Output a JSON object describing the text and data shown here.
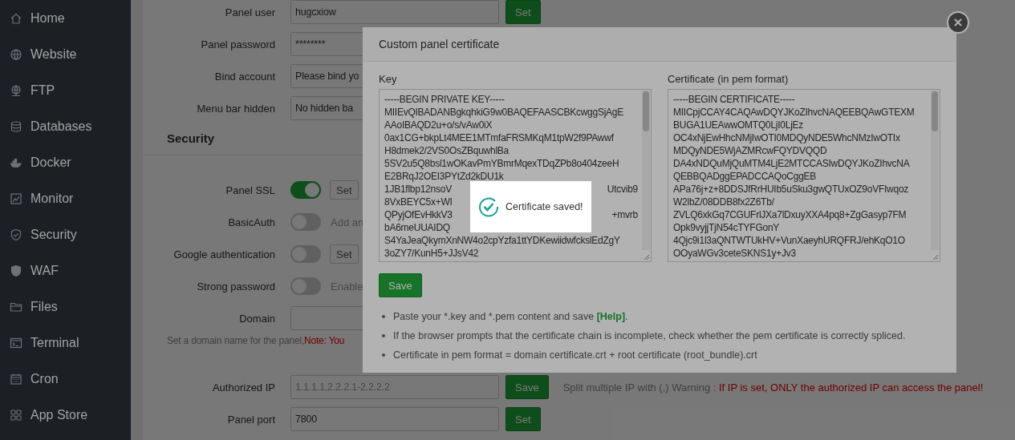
{
  "sidebar": {
    "items": [
      {
        "label": "Home"
      },
      {
        "label": "Website"
      },
      {
        "label": "FTP"
      },
      {
        "label": "Databases"
      },
      {
        "label": "Docker"
      },
      {
        "label": "Monitor"
      },
      {
        "label": "Security"
      },
      {
        "label": "WAF"
      },
      {
        "label": "Files"
      },
      {
        "label": "Terminal"
      },
      {
        "label": "Cron"
      },
      {
        "label": "App Store"
      }
    ]
  },
  "settings": {
    "rows": [
      {
        "kind": "input",
        "label": "Panel user",
        "value": "hugcxiow",
        "button": "Set"
      },
      {
        "kind": "input",
        "label": "Panel password",
        "value": "********"
      },
      {
        "kind": "select",
        "label": "Bind account",
        "value": "Please bind yo"
      },
      {
        "kind": "select",
        "label": "Menu bar hidden",
        "value": "No hidden ba"
      },
      {
        "kind": "heading",
        "text": "Security"
      },
      {
        "kind": "toggle",
        "label": "Panel SSL",
        "on": true,
        "button": "Set"
      },
      {
        "kind": "toggle",
        "label": "BasicAuth",
        "on": false,
        "note": "Add an"
      },
      {
        "kind": "toggle",
        "label": "Google authentication",
        "on": false,
        "button": "Set"
      },
      {
        "kind": "toggle",
        "label": "Strong password",
        "on": false,
        "note": "Enable"
      },
      {
        "kind": "input",
        "label": "Domain"
      },
      {
        "kind": "hint",
        "text": "Set a domain name for the panel,",
        "warning": "Note: You"
      },
      {
        "kind": "input",
        "label": "Authorized IP",
        "placeholder": "1.1.1.1,2.2.2.1-2.2.2.2",
        "button": "Save",
        "hint": "Split multiple IP with (,) Warning : ",
        "warning": "If IP is set, ONLY the authorized IP can access the panel!"
      },
      {
        "kind": "input",
        "label": "Panel port",
        "value": "7800",
        "button": "Set"
      }
    ]
  },
  "dialog": {
    "title": "Custom panel certificate",
    "key": {
      "label": "Key",
      "lines": [
        {
          "text": "-----BEGIN PRIVATE KEY-----"
        },
        {
          "text": "MIIEvQIBADANBgkqhkiG9w0BAQEFAASCBKcwggSjAgE"
        },
        {
          "text": "AAoIBAQD2u+o/s/vAw0iX"
        },
        {
          "text": "0ax1CG+bkpLt4MEE1MTmfaFRSMKqM1tpW2f9PAwwf"
        },
        {
          "text": "H8dmek2/2VS0OsZBquwhlBa"
        },
        {
          "text": "5SV2u5Q8bsl1wOKavPmYBmrMqexTDqZPb8o404zeeH"
        },
        {
          "text": "E2BRqJ2OEI3PYtZd2kDU1k"
        },
        {
          "start": "1JB1flbp12nsoV",
          "end": "Utcvib9"
        },
        {
          "start": "8VxBEYC5x+WI"
        },
        {
          "start": "QPyjOfEvHkkV3",
          "end": "+mvrb"
        },
        {
          "start": "bA6meUUAIDQ"
        },
        {
          "text": "S4YaJeaQkymXnNW4o2cpYzfa1ttYDKewiidwfckslEdZgY"
        },
        {
          "text": "3oZY7/KunH5+JJsV42"
        }
      ]
    },
    "certificate": {
      "label": "Certificate (in pem format)",
      "lines": [
        {
          "text": "-----BEGIN CERTIFICATE-----"
        },
        {
          "text": "MIICpjCCAY4CAQAwDQYJKoZIhvcNAQEEBQAwGTEXM"
        },
        {
          "text": "BUGA1UEAwwOMTQ0LjI0LjEz"
        },
        {
          "text": "OC4xNjEwHhcNMjIwOTI0MDQyNDE5WhcNMzIwOTIx"
        },
        {
          "text": "MDQyNDE5WjAZMRcwFQYDVQQD"
        },
        {
          "text": "DA4xNDQuMjQuMTM4LjE2MTCCASIwDQYJKoZIhvcNA"
        },
        {
          "text": "QEBBQADggEPADCCAQoCggEB"
        },
        {
          "text": "APa76j+z+8DDSJfRrHUIb5uSku3gwQTUxOZ9oVFIwqoz"
        },
        {
          "text": "W2lbZ/08DDB8fx2Z6Tb/"
        },
        {
          "text": "ZVLQ6xkGq7CGUFrlJXa7lDxuyXXA4pq8+ZgGasyp7FM"
        },
        {
          "text": "Opk9vyjjTjN54cTYFGonY"
        },
        {
          "text": "4Qjc9i1l3aQNTWTUkHV+VunXaeyhURQFRJ/ehKqO1O"
        },
        {
          "text": "OOyaWGv3ceteSKNS1y+Jv3"
        }
      ]
    },
    "save_button": "Save",
    "notes": [
      {
        "text": "Paste your *.key and *.pem content and save ",
        "link": "[Help]",
        "after": "."
      },
      {
        "text": "If the browser prompts that the certificate chain is incomplete, check whether the pem certificate is correctly spliced."
      },
      {
        "text": "Certificate in pem format = domain certificate.crt + root certificate (root_bundle).crt"
      }
    ]
  },
  "toast": {
    "message": "Certificate saved!"
  }
}
